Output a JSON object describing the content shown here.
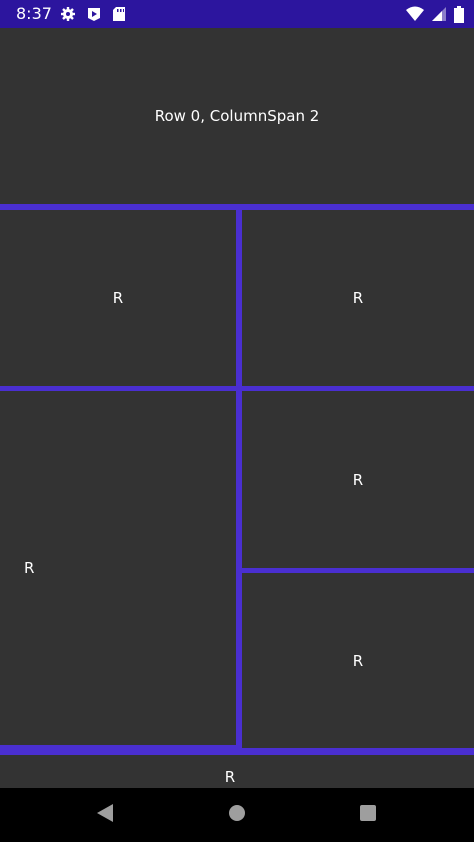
{
  "status_bar": {
    "time": "8:37",
    "left_icons": [
      "gear-icon",
      "play-store-icon",
      "sd-card-icon"
    ],
    "right_icons": [
      "wifi-icon",
      "signal-icon",
      "battery-icon"
    ]
  },
  "grid": {
    "header_cell": "Row 0, ColumnSpan 2",
    "cells": [
      "R",
      "R",
      "R",
      "R",
      "R",
      "R"
    ]
  },
  "colors": {
    "status_bar": "#2c159e",
    "grid_background": "#4a2fd1",
    "cell_background": "#333333",
    "nav_bar": "#000000"
  },
  "nav_bar": {
    "buttons": [
      "back-icon",
      "home-icon",
      "recents-icon"
    ]
  }
}
